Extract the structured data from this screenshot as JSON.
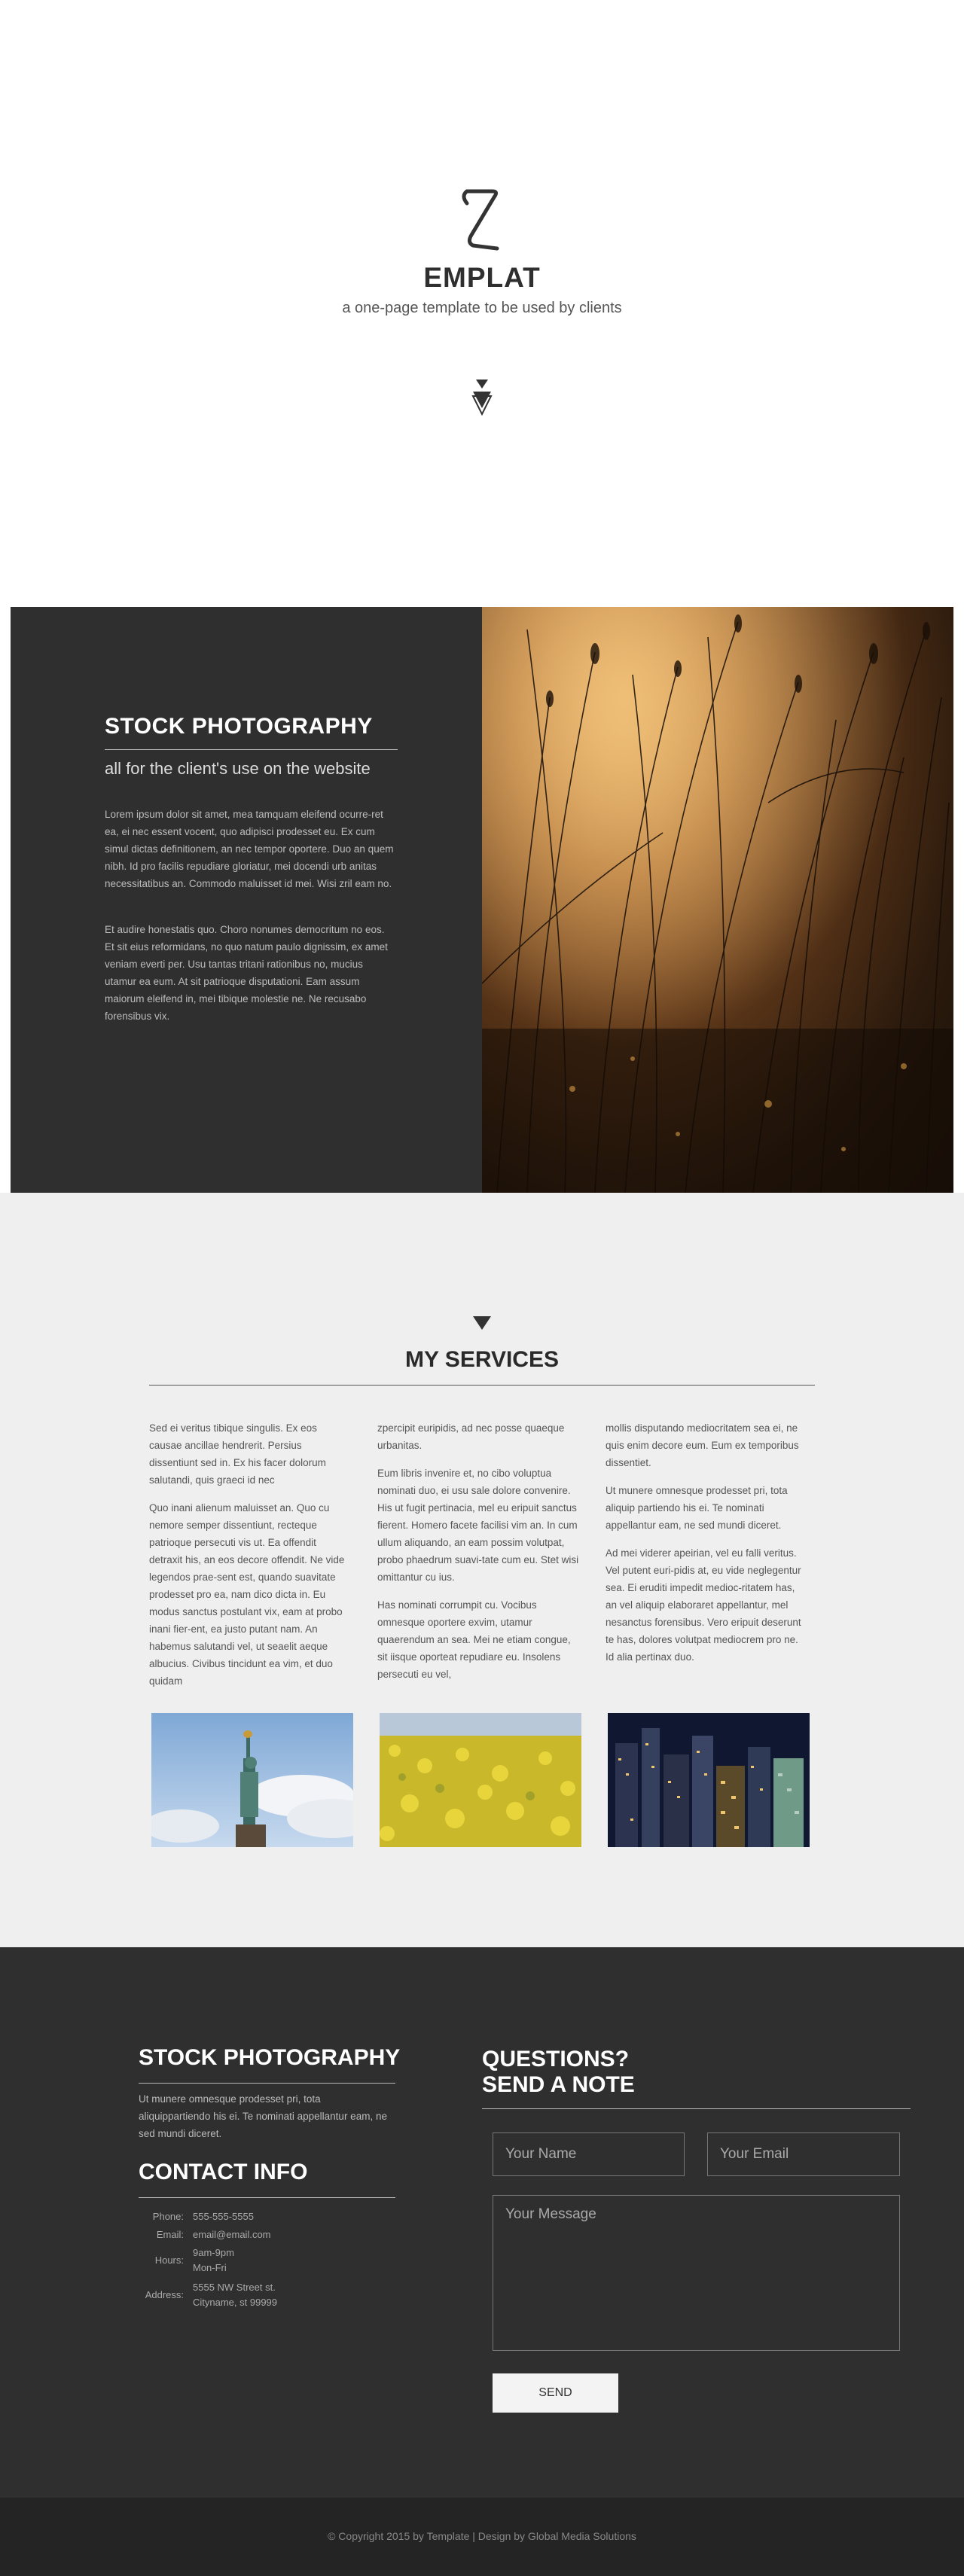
{
  "hero": {
    "logo_icon": "s-logo-icon",
    "title": "EMPLAT",
    "subtitle": "a one-page template to be used by clients",
    "scroll_icon": "double-triangle-down-icon"
  },
  "stock": {
    "heading": "STOCK PHOTOGRAPHY",
    "tagline": "all for the client's use on the website",
    "paragraph1": "Lorem ipsum dolor sit amet, mea tamquam eleifend ocurre-ret ea, ei nec essent vocent, quo adipisci prodesset eu. Ex cum simul dictas definitionem, an nec tempor oportere. Duo an quem nibh. Id pro facilis repudiare gloriatur, mei docendi urb anitas necessitatibus an. Commodo maluisset id mei. Wisi zril eam no.",
    "paragraph2": "Et audire honestatis quo. Choro nonumes democritum no eos. Et sit eius reformidans, no quo natum paulo dignissim, ex amet veniam everti per. Usu tantas tritani rationibus no, mucius utamur ea eum. At sit patrioque disputationi. Eam assum maiorum eleifend in, mei tibique molestie ne. Ne recusabo forensibus vix.",
    "photo_subject": "backlit grass at sunset"
  },
  "services": {
    "arrow_icon": "triangle-down-icon",
    "title": "MY SERVICES",
    "columns": [
      {
        "paragraphs": [
          "Sed ei veritus tibique singulis. Ex eos causae ancillae hendrerit. Persius dissentiunt sed in. Ex his facer dolorum salutandi, quis graeci id nec",
          "Quo inani alienum maluisset an. Quo cu nemore semper dissentiunt, recteque patrioque persecuti vis ut. Ea offendit detraxit his, an eos decore offendit. Ne vide legendos prae-sent est, quando suavitate prodesset pro ea, nam dico dicta in. Eu modus sanctus postulant vix, eam at probo inani fier-ent, ea justo putant nam. An habemus salutandi vel, ut seaelit aeque albucius. Civibus tincidunt ea vim, et duo quidam"
        ]
      },
      {
        "paragraphs": [
          "zpercipit euripidis, ad nec posse quaeque urbanitas.",
          "Eum libris invenire et, no cibo voluptua nominati duo, ei usu sale dolore convenire. His ut fugit pertinacia, mel eu eripuit sanctus fierent. Homero facete facilisi vim an. In cum ullum aliquando, an eam possim volutpat, probo phaedrum suavi-tate cum eu. Stet wisi omittantur cu ius.",
          "Has nominati corrumpit cu. Vocibus omnesque oportere exvim, utamur quaerendum an sea. Mei ne etiam congue, sit iisque oporteat repudiare eu. Insolens persecuti eu vel,"
        ]
      },
      {
        "paragraphs": [
          "mollis disputando mediocritatem sea ei, ne quis enim decore eum. Eum ex temporibus dissentiet.",
          "Ut munere omnesque prodesset pri, tota aliquip partiendo his ei. Te nominati appellantur eam, ne sed mundi diceret.",
          "Ad mei viderer apeirian, vel eu falli veritus. Vel putent euri-pidis at, eu vide neglegentur sea. Ei eruditi impedit medioc-ritatem has, an vel aliquip elaboraret appellantur, mel nesanctus forensibus. Vero eripuit deserunt te has, dolores volutpat mediocrem pro ne. Id alia pertinax duo."
        ]
      }
    ],
    "images": [
      {
        "name": "statue-of-liberty-image"
      },
      {
        "name": "yellow-flower-field-image"
      },
      {
        "name": "night-city-skyline-image"
      }
    ]
  },
  "contact": {
    "about_heading": "STOCK PHOTOGRAPHY",
    "about_text": "Ut munere omnesque prodesset pri, tota aliquippartiendo his ei. Te nominati appellantur eam, ne sed mundi diceret.",
    "info_heading": "CONTACT INFO",
    "info": {
      "phone_label": "Phone:",
      "phone": "555-555-5555",
      "email_label": "Email:",
      "email": "email@email.com",
      "hours_label": "Hours:",
      "hours_line1": "9am-9pm",
      "hours_line2": "Mon-Fri",
      "address_label": "Address:",
      "address_line1": "5555 NW Street st.",
      "address_line2": "Cityname, st 99999"
    },
    "form_heading_line1": "QUESTIONS?",
    "form_heading_line2": "SEND A NOTE",
    "name_placeholder": "Your Name",
    "email_placeholder": "Your Email",
    "message_placeholder": "Your Message",
    "send_label": "SEND"
  },
  "footer": {
    "copyright": "© Copyright 2015 by Template | Design by Global Media Solutions"
  }
}
